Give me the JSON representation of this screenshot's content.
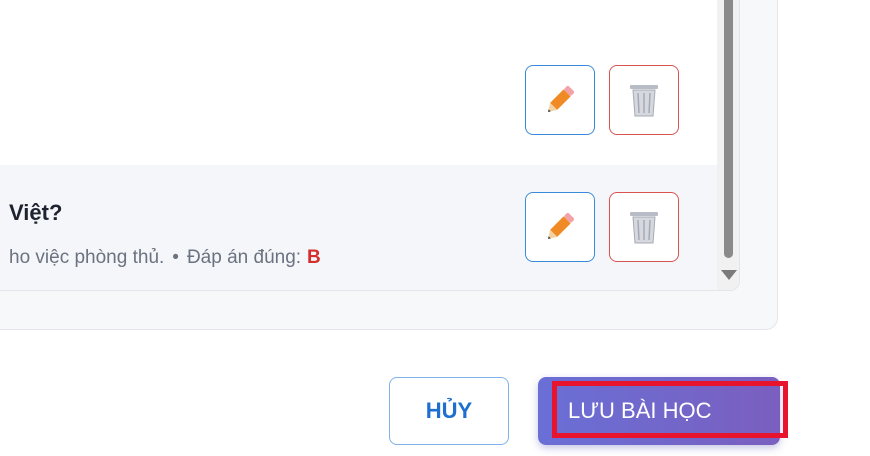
{
  "questions": [
    {
      "title": "Việt?",
      "meta_text": "ho việc phòng thủ.",
      "separator": "•",
      "answer_label": "Đáp án đúng:",
      "answer_value": "B"
    }
  ],
  "footer": {
    "cancel_label": "HỦY",
    "save_label": "LƯU BÀI HỌC"
  },
  "colors": {
    "edit_border": "#3b8ad9",
    "delete_border": "#d9534f",
    "answer": "#d32f2f",
    "save_gradient_start": "#6a6fd6",
    "save_gradient_end": "#7a5fbf",
    "highlight": "#e8132d"
  },
  "icons": {
    "edit": "pencil-icon",
    "delete": "trash-icon"
  }
}
